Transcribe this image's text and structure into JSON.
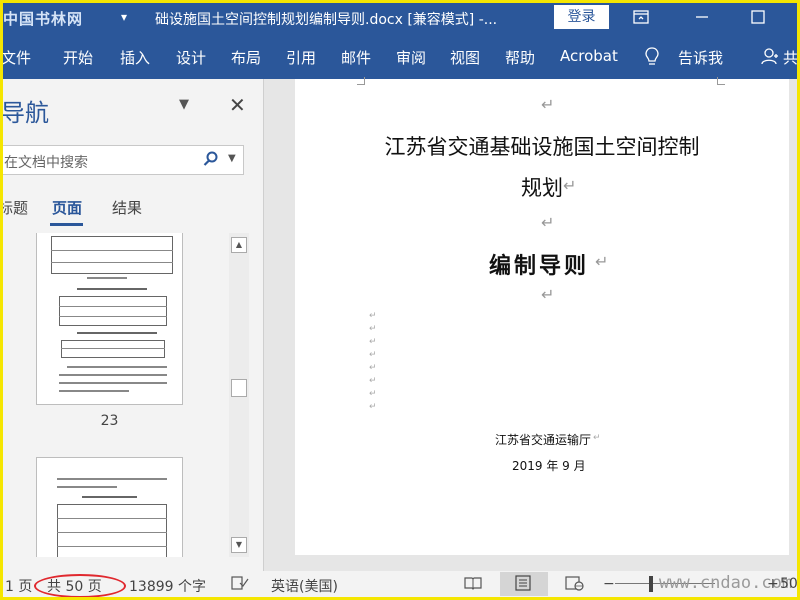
{
  "titlebar": {
    "watermark": "中国书林网",
    "quick_access": "▾",
    "title": "础设施国土空间控制规划编制导则.docx [兼容模式] -...",
    "login_label": "登录",
    "icons": [
      "ribbon-display-icon",
      "minimize-icon",
      "maximize-icon"
    ]
  },
  "ribbon": {
    "tabs": [
      "文件",
      "开始",
      "插入",
      "设计",
      "布局",
      "引用",
      "邮件",
      "审阅",
      "视图",
      "帮助",
      "Acrobat"
    ],
    "tell_me": "告诉我",
    "share": "共"
  },
  "nav": {
    "title": "导航",
    "search_placeholder": "在文档中搜索",
    "tabs": [
      "标题",
      "页面",
      "结果"
    ],
    "active_tab": "页面",
    "thumb_page_number": "23"
  },
  "document": {
    "title_line1": "江苏省交通基础设施国土空间控制",
    "title_line2": "规划",
    "subtitle": "编制导则",
    "organization": "江苏省交通运输厅",
    "date": "2019 年 9 月",
    "para_mark": "↵"
  },
  "statusbar": {
    "page": "1 页",
    "total_pages": "共 50 页",
    "word_count": "13899 个字",
    "language": "英语(美国)",
    "zoom_minus": "−",
    "zoom_plus": "+",
    "zoom_level": "50",
    "site_watermark": "www.cndao.com"
  }
}
